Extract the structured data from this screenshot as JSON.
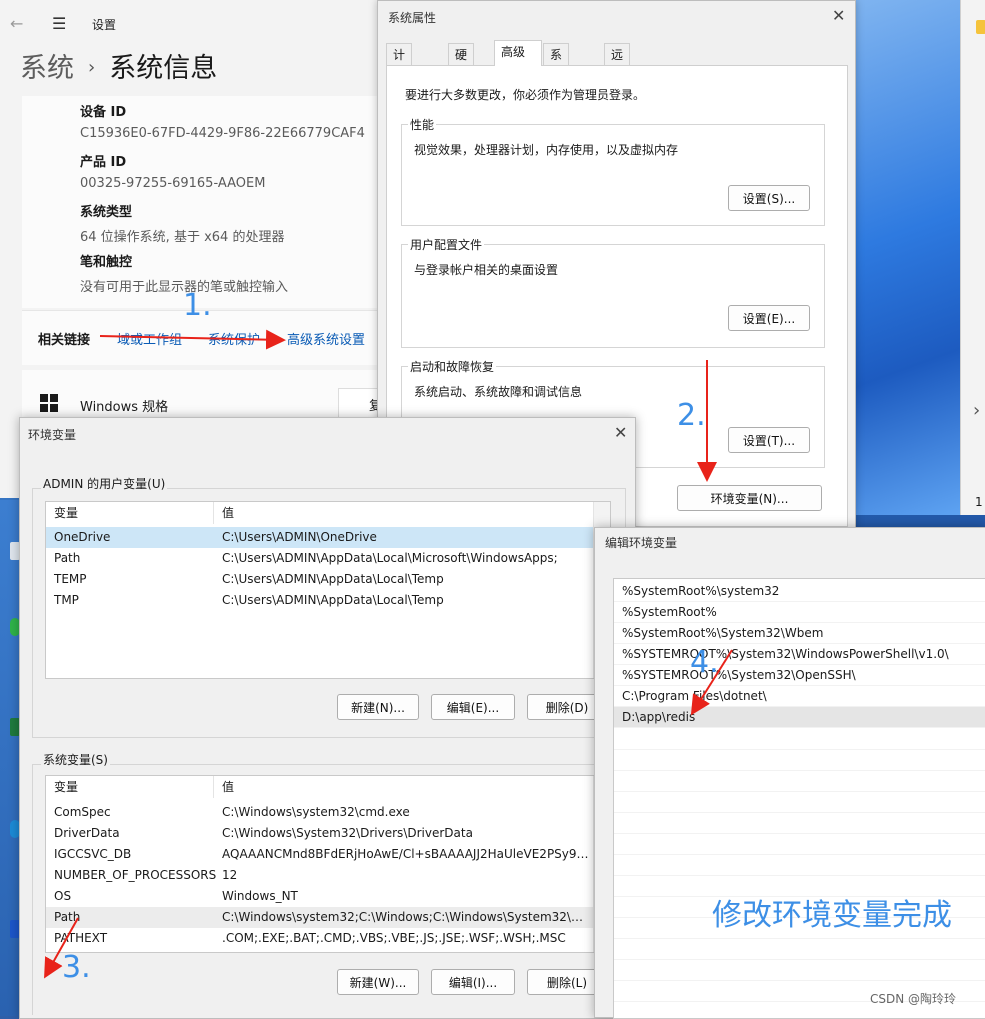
{
  "settings": {
    "back_glyph": "←",
    "menu_glyph": "☰",
    "title": "设置",
    "breadcrumb_parent": "系统",
    "breadcrumb_sep": "›",
    "breadcrumb_current": "系统信息",
    "fields": [
      {
        "label": "设备 ID",
        "value": "C15936E0-67FD-4429-9F86-22E66779CAF4"
      },
      {
        "label": "产品 ID",
        "value": "00325-97255-69165-AAOEM"
      },
      {
        "label": "系统类型",
        "value": "64 位操作系统, 基于 x64 的处理器"
      },
      {
        "label": "笔和触控",
        "value": "没有可用于此显示器的笔或触控输入"
      }
    ],
    "related_links_label": "相关链接",
    "links": [
      "域或工作组",
      "系统保护",
      "高级系统设置"
    ],
    "windows_spec": "Windows 规格",
    "copy_partial": "复"
  },
  "sysprop": {
    "title": "系统属性",
    "close": "✕",
    "tabs": [
      "计算机名",
      "硬件",
      "高级",
      "系统保护",
      "远程"
    ],
    "active_tab": "高级",
    "admin_note": "要进行大多数更改，你必须作为管理员登录。",
    "groups": [
      {
        "title": "性能",
        "desc": "视觉效果，处理器计划，内存使用，以及虚拟内存",
        "button": "设置(S)..."
      },
      {
        "title": "用户配置文件",
        "desc": "与登录帐户相关的桌面设置",
        "button": "设置(E)..."
      },
      {
        "title": "启动和故障恢复",
        "desc": "系统启动、系统故障和调试信息",
        "button": "设置(T)..."
      }
    ],
    "env_button": "环境变量(N)..."
  },
  "envvars": {
    "title": "环境变量",
    "close": "✕",
    "user_section": "ADMIN 的用户变量(U)",
    "col_var": "变量",
    "col_val": "值",
    "user_rows": [
      {
        "name": "OneDrive",
        "value": "C:\\Users\\ADMIN\\OneDrive"
      },
      {
        "name": "Path",
        "value": "C:\\Users\\ADMIN\\AppData\\Local\\Microsoft\\WindowsApps;"
      },
      {
        "name": "TEMP",
        "value": "C:\\Users\\ADMIN\\AppData\\Local\\Temp"
      },
      {
        "name": "TMP",
        "value": "C:\\Users\\ADMIN\\AppData\\Local\\Temp"
      }
    ],
    "user_buttons": [
      "新建(N)...",
      "编辑(E)...",
      "删除(D)"
    ],
    "system_section": "系统变量(S)",
    "system_rows": [
      {
        "name": "ComSpec",
        "value": "C:\\Windows\\system32\\cmd.exe"
      },
      {
        "name": "DriverData",
        "value": "C:\\Windows\\System32\\Drivers\\DriverData"
      },
      {
        "name": "IGCCSVC_DB",
        "value": "AQAAANCMnd8BFdERjHoAwE/Cl+sBAAAAJJ2HaUleVE2PSy9R..."
      },
      {
        "name": "NUMBER_OF_PROCESSORS",
        "value": "12"
      },
      {
        "name": "OS",
        "value": "Windows_NT"
      },
      {
        "name": "Path",
        "value": "C:\\Windows\\system32;C:\\Windows;C:\\Windows\\System32\\Wb..."
      },
      {
        "name": "PATHEXT",
        "value": ".COM;.EXE;.BAT;.CMD;.VBS;.VBE;.JS;.JSE;.WSF;.WSH;.MSC"
      }
    ],
    "system_buttons": [
      "新建(W)...",
      "编辑(I)...",
      "删除(L)"
    ]
  },
  "editenv": {
    "title": "编辑环境变量",
    "paths": [
      "%SystemRoot%\\system32",
      "%SystemRoot%",
      "%SystemRoot%\\System32\\Wbem",
      "%SYSTEMROOT%\\System32\\WindowsPowerShell\\v1.0\\",
      "%SYSTEMROOT%\\System32\\OpenSSH\\",
      "C:\\Program Files\\dotnet\\",
      "D:\\app\\redis"
    ]
  },
  "annotations": {
    "step1": "1.",
    "step2": "2.",
    "step3": "3.",
    "step4": "4.",
    "done": "修改环境变量完成",
    "arrow_color": "#e8231a",
    "text_color": "#3d8fe6"
  },
  "right_window": {
    "chevron": "›",
    "number": "1"
  },
  "watermark": "CSDN @陶玲玲"
}
